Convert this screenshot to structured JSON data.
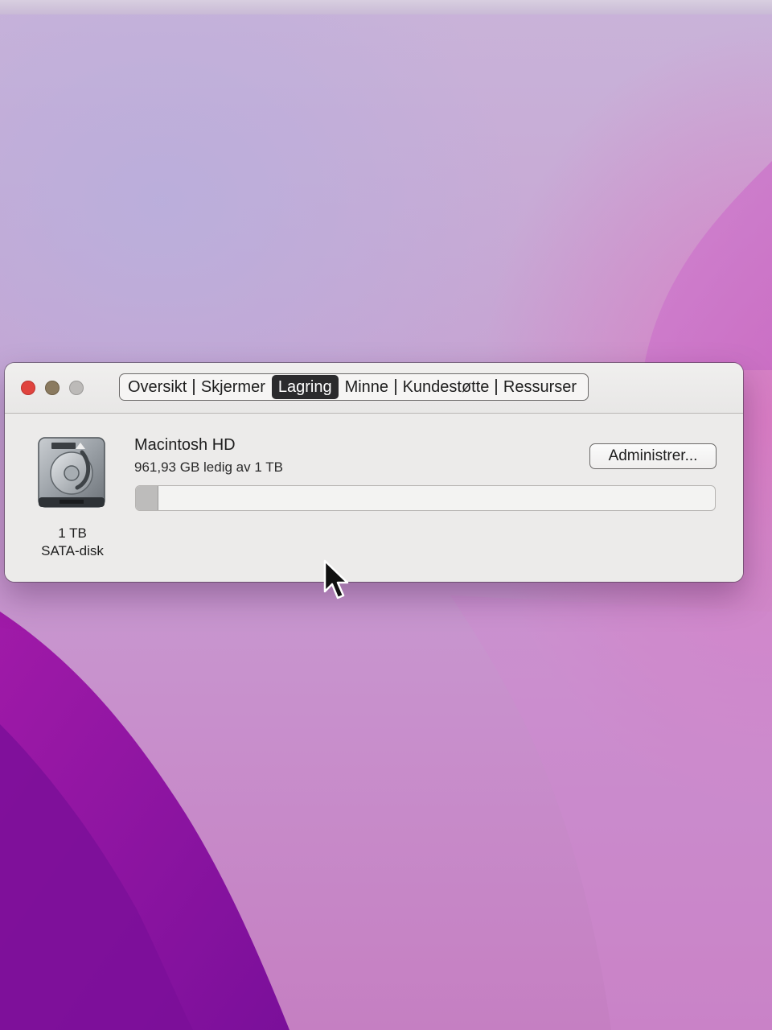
{
  "window": {
    "tabs": [
      {
        "label": "Oversikt",
        "active": false
      },
      {
        "label": "Skjermer",
        "active": false
      },
      {
        "label": "Lagring",
        "active": true
      },
      {
        "label": "Minne",
        "active": false
      },
      {
        "label": "Kundestøtte",
        "active": false
      },
      {
        "label": "Ressurser",
        "active": false
      }
    ]
  },
  "storage": {
    "disk_size": "1 TB",
    "disk_type": "SATA-disk",
    "volume_name": "Macintosh HD",
    "free_text": "961,93 GB ledig av 1 TB",
    "manage_label": "Administrer...",
    "used_fraction": 0.038
  },
  "icons": {
    "disk": "hard-drive-icon",
    "cursor": "mouse-pointer-icon"
  },
  "colors": {
    "close": "#e0443e",
    "minimize": "#8a7a5f",
    "zoom": "#bcbab8",
    "active_tab": "#2b2b2d"
  }
}
